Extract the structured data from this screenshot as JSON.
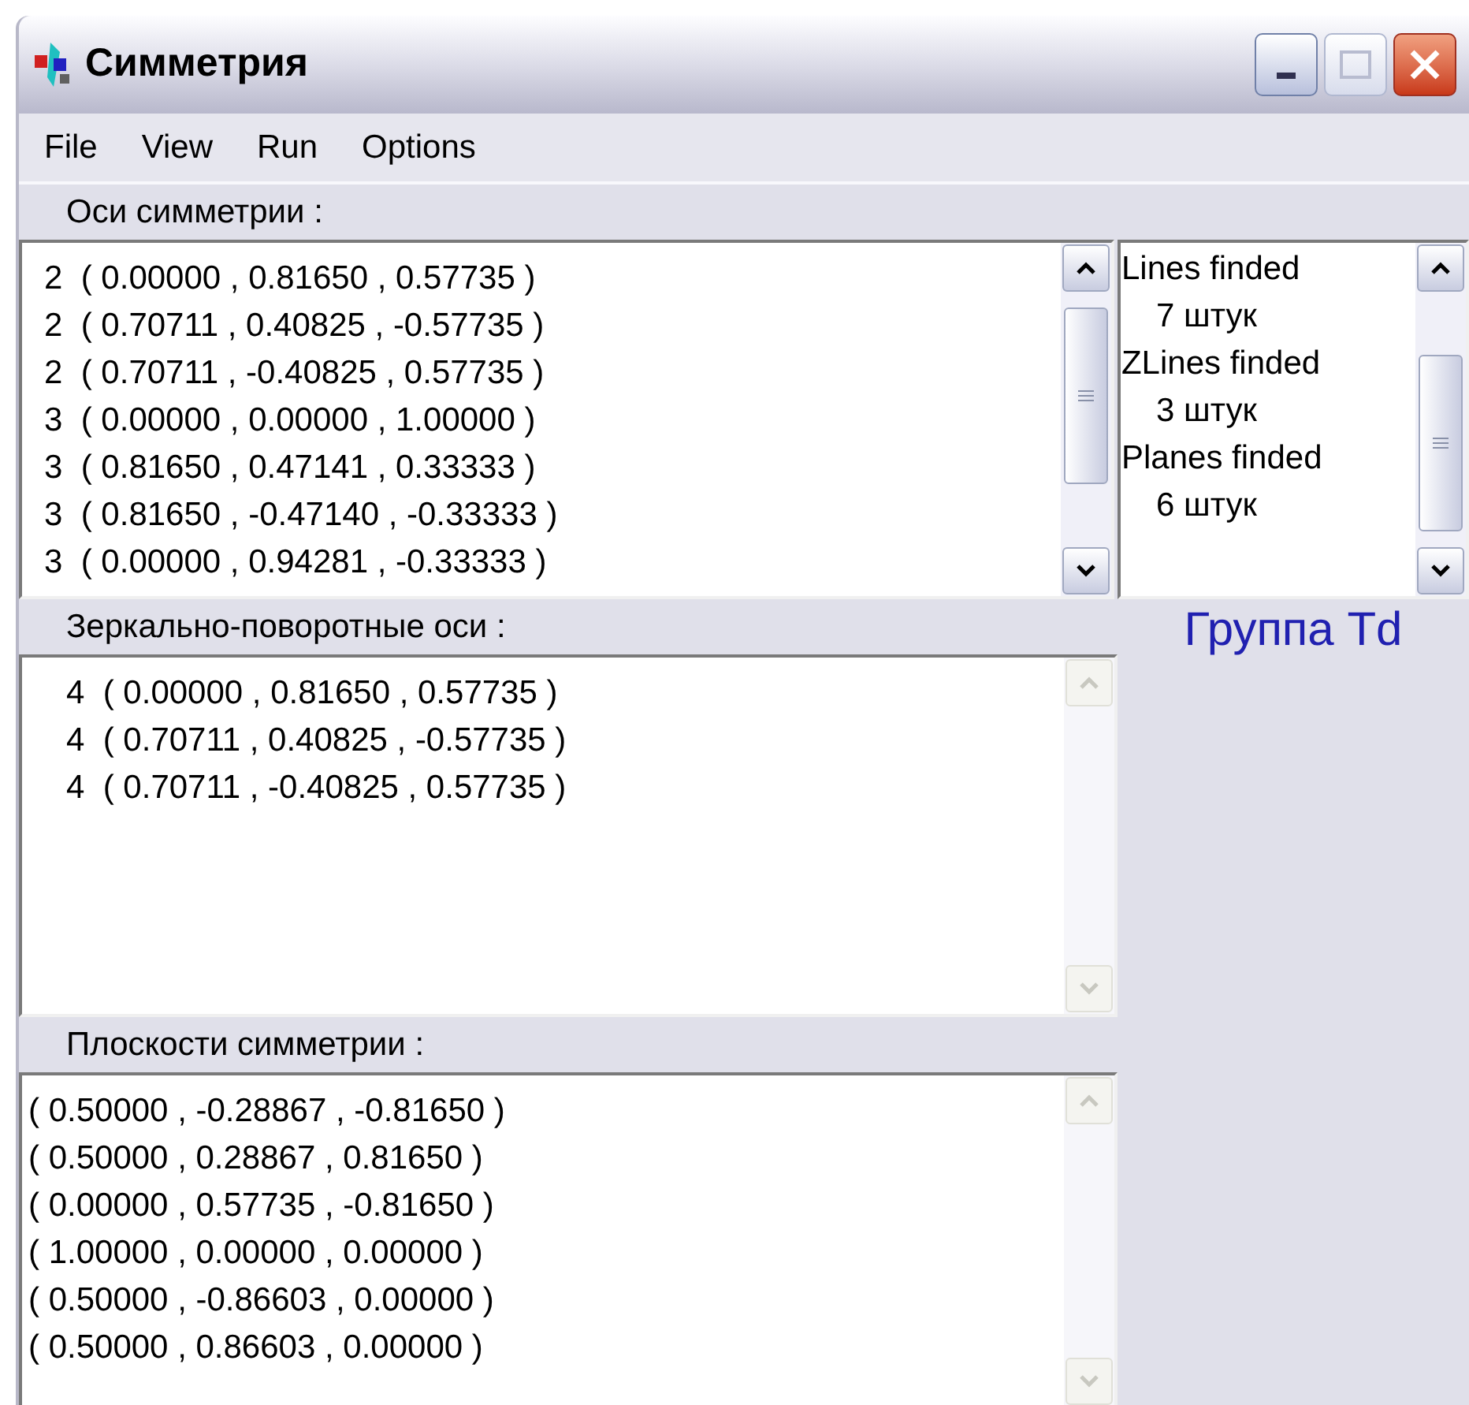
{
  "window": {
    "title": "Симметрия"
  },
  "menu": [
    {
      "label": "File"
    },
    {
      "label": "View"
    },
    {
      "label": "Run"
    },
    {
      "label": "Options"
    }
  ],
  "axes": {
    "header": "Оси симметрии :",
    "scroll_enabled": true,
    "lines": [
      "2  ( 0.00000 , 0.81650 , 0.57735 )",
      "2  ( 0.70711 , 0.40825 , -0.57735 )",
      "2  ( 0.70711 , -0.40825 , 0.57735 )",
      "3  ( 0.00000 , 0.00000 , 1.00000 )",
      "3  ( 0.81650 , 0.47141 , 0.33333 )",
      "3  ( 0.81650 , -0.47140 , -0.33333 )",
      "3  ( 0.00000 , 0.94281 , -0.33333 )"
    ]
  },
  "summary": {
    "scroll_enabled": true,
    "items": [
      {
        "title": "Lines finded",
        "count": "7 штук"
      },
      {
        "title": "ZLines finded",
        "count": "3 штук"
      },
      {
        "title": "Planes finded",
        "count": "6 штук"
      }
    ]
  },
  "group_label": "Группа Td",
  "rotoreflection": {
    "header": "Зеркально-поворотные оси :",
    "scroll_enabled": false,
    "lines": [
      "4  ( 0.00000 , 0.81650 , 0.57735 )",
      "4  ( 0.70711 , 0.40825 , -0.57735 )",
      "4  ( 0.70711 , -0.40825 , 0.57735 )"
    ]
  },
  "planes": {
    "header": "Плоскости симметрии :",
    "scroll_enabled": false,
    "lines": [
      "( 0.50000 , -0.28867 , -0.81650 )",
      "( 0.50000 , 0.28867 , 0.81650 )",
      "( 0.00000 , 0.57735 , -0.81650 )",
      "( 1.00000 , 0.00000 , 0.00000 )",
      "( 0.50000 , -0.86603 , 0.00000 )",
      "( 0.50000 , 0.86603 , 0.00000 )"
    ]
  }
}
